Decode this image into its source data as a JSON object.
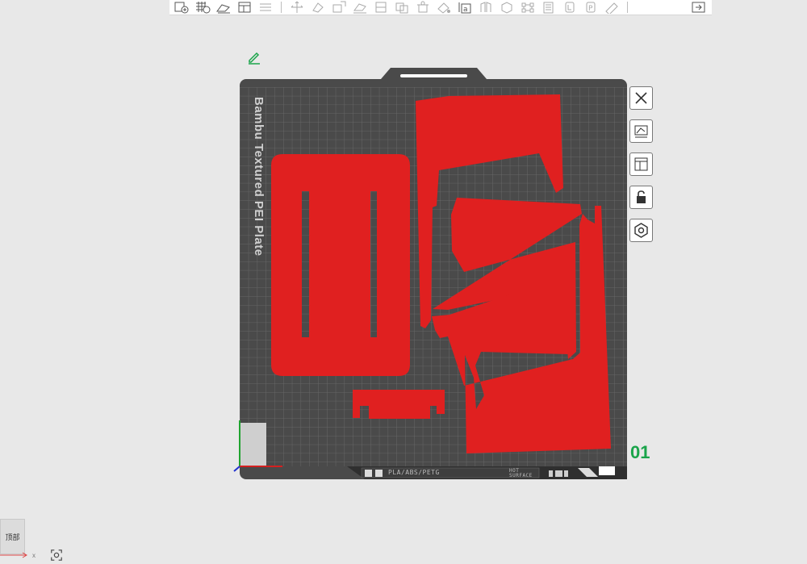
{
  "toolbar": {
    "buttons": [
      "add-plate-icon",
      "arrange-grid-icon",
      "auto-orient-icon",
      "split-plate-icon",
      "layers-icon",
      "move-icon",
      "rotate-icon",
      "scale-icon",
      "lay-on-face-icon",
      "cut-icon",
      "support-paint-icon",
      "seam-paint-icon",
      "color-paint-icon",
      "fuzzy-skin-icon",
      "text-icon",
      "measure-icon",
      "assembly-icon",
      "boolean-icon",
      "mesh-repair-icon",
      "brim-ears-icon",
      "variable-layer-icon",
      "prime-tower-icon",
      "ruler-icon"
    ],
    "end_button": "collapse-sidebar-icon"
  },
  "plate": {
    "label": "Bambu Textured PEI Plate",
    "index": "01",
    "strip_material": "PLA/ABS/PETG",
    "strip_surface_1": "HOT",
    "strip_surface_2": "SURFACE",
    "accent": "#1aa44a",
    "part_color": "#e02020",
    "plate_color": "#4a4a4a"
  },
  "side_tools": [
    "close-plate-icon",
    "arrange-plate-icon",
    "orient-plate-icon",
    "lock-plate-icon",
    "plate-settings-icon"
  ],
  "viewcube": {
    "face_label": "顶部",
    "axis_x": "x"
  }
}
